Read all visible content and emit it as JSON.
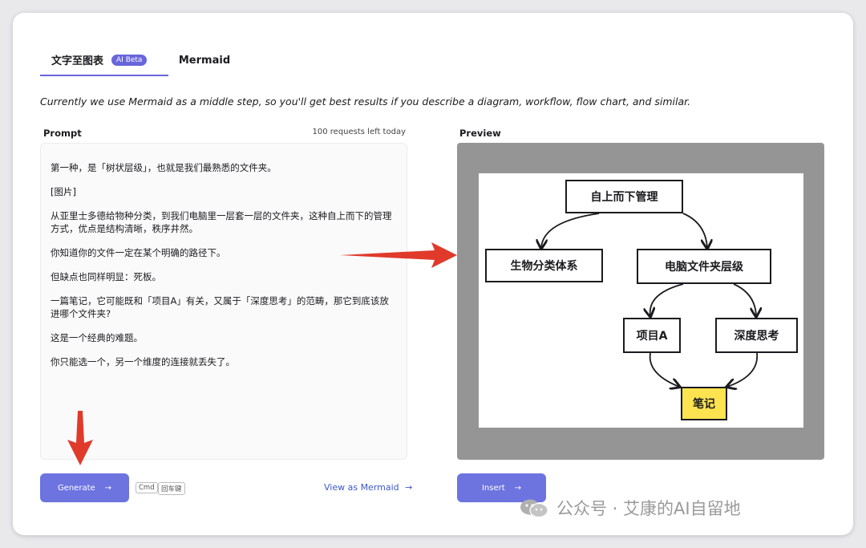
{
  "tabs": {
    "text_to_diagram": "文字至图表",
    "ai_badge": "AI Beta",
    "mermaid": "Mermaid"
  },
  "intro": "Currently we use Mermaid as a middle step, so you'll get best results if you describe a diagram, workflow, flow chart, and similar.",
  "prompt": {
    "label": "Prompt",
    "requests_left": "100 requests left today",
    "paragraphs": [
      "第一种，是「树状层级」，也就是我们最熟悉的文件夹。",
      "[图片]",
      "从亚里士多德给物种分类，到我们电脑里一层套一层的文件夹，这种自上而下的管理方式，优点是结构清晰，秩序井然。",
      "你知道你的文件一定在某个明确的路径下。",
      "但缺点也同样明显：死板。",
      "一篇笔记，它可能既和「项目A」有关，又属于「深度思考」的范畴，那它到底该放进哪个文件夹?",
      "这是一个经典的难题。",
      "你只能选一个，另一个维度的连接就丢失了。"
    ]
  },
  "preview": {
    "label": "Preview",
    "nodes": {
      "top": "自上而下管理",
      "bio": "生物分类体系",
      "folder": "电脑文件夹层级",
      "project": "项目A",
      "deep": "深度思考",
      "note": "笔记"
    }
  },
  "actions": {
    "generate": "Generate",
    "kbd_cmd": "Cmd",
    "kbd_enter": "回车键",
    "view_mermaid": "View as Mermaid",
    "insert": "Insert"
  },
  "watermark": "公众号 · 艾康的AI自留地",
  "colors": {
    "accent": "#6965db",
    "button": "#6d74e0",
    "note_fill": "#fce34f",
    "annotation_arrow": "#e03a2b"
  }
}
